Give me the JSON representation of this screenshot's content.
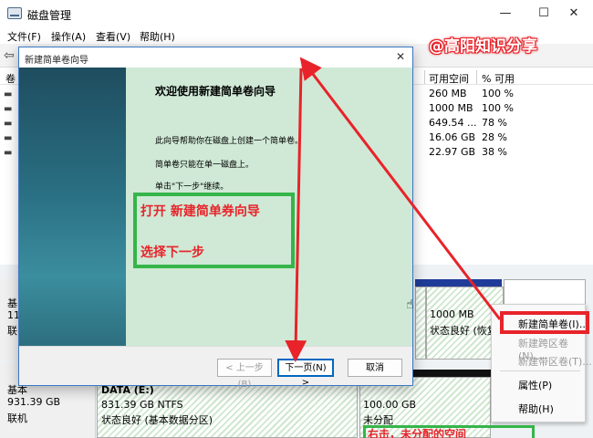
{
  "window": {
    "title": "磁盘管理",
    "minimize": "—",
    "maximize": "☐",
    "close": "✕"
  },
  "menu": [
    "文件(F)",
    "操作(A)",
    "查看(V)",
    "帮助(H)"
  ],
  "volume_table": {
    "headers": {
      "volume": "卷",
      "free": "可用空间",
      "percent": "% 可用"
    },
    "rows": [
      {
        "free": "260 MB",
        "percent": "100 %"
      },
      {
        "free": "1000 MB",
        "percent": "100 %"
      },
      {
        "free": "649.54 ...",
        "percent": "78 %"
      },
      {
        "free": "16.06 GB",
        "percent": "28 %"
      },
      {
        "free": "22.97 GB",
        "percent": "38 %"
      }
    ]
  },
  "disk0": {
    "label_type": "基",
    "label_size": "11",
    "label_status": "联"
  },
  "disk1": {
    "label_type": "基本",
    "label_size": "931.39 GB",
    "label_status": "联机"
  },
  "partition_recovery": {
    "size": "1000 MB",
    "status": "状态良好 (恢复"
  },
  "partition_data": {
    "name": "DATA (E:)",
    "size": "831.39 GB NTFS",
    "status": "状态良好 (基本数据分区)"
  },
  "partition_unallocated": {
    "size": "100.00 GB",
    "status": "未分配"
  },
  "context_menu": {
    "items": [
      {
        "label": "新建简单卷(I)...",
        "disabled": false
      },
      {
        "label": "新建跨区卷(N)...",
        "disabled": true
      },
      {
        "label": "新建带区卷(T)...",
        "disabled": true
      },
      {
        "label": "属性(P)",
        "disabled": false
      },
      {
        "label": "帮助(H)",
        "disabled": false
      }
    ]
  },
  "wizard": {
    "title": "新建简单卷向导",
    "close": "✕",
    "heading": "欢迎使用新建简单卷向导",
    "line1": "此向导帮助你在磁盘上创建一个简单卷。",
    "line2": "简单卷只能在单一磁盘上。",
    "line3": "单击\"下一步\"继续。",
    "back_label": "< 上一步(B)",
    "next_label": "下一页(N) >",
    "cancel_label": "取消"
  },
  "annotation": {
    "line1": "打开 新建简单券向导",
    "line2": "选择下一步",
    "watermark": "@高阳知识分享",
    "bottom_note": "右击，未分配的空间"
  },
  "colors": {
    "annotation_red": "#e8232a",
    "annotation_green": "#35b54a",
    "accent_blue": "#0067c0"
  }
}
